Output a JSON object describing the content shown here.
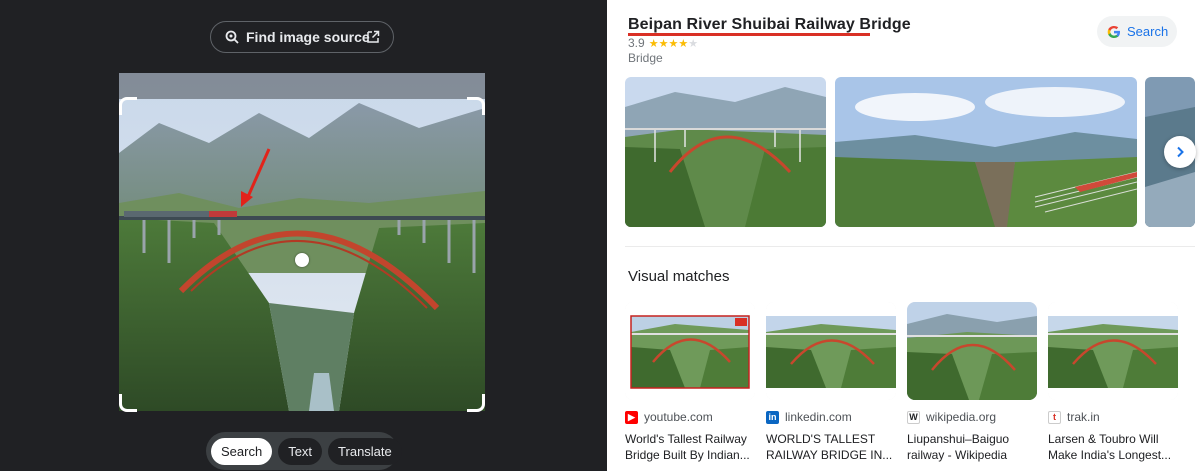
{
  "lens": {
    "find_source_label": "Find image source",
    "modes": [
      "Search",
      "Text",
      "Translate"
    ],
    "active_mode": "Search"
  },
  "entity": {
    "title": "Beipan River Shuibai Railway Bridge",
    "rating": "3.9",
    "rating_value": 3.9,
    "rating_max": 5,
    "type": "Bridge",
    "search_label": "Search"
  },
  "visual_matches": {
    "heading": "Visual matches",
    "items": [
      {
        "source": "youtube.com",
        "caption_line1": "World's Tallest Railway",
        "caption_line2": "Bridge Built By Indian..."
      },
      {
        "source": "linkedin.com",
        "caption_line1": "WORLD'S TALLEST",
        "caption_line2": "RAILWAY BRIDGE IN..."
      },
      {
        "source": "wikipedia.org",
        "caption_line1": "Liupanshui–Baiguo",
        "caption_line2": "railway - Wikipedia"
      },
      {
        "source": "trak.in",
        "caption_line1": "Larsen & Toubro Will",
        "caption_line2": "Make India's Longest..."
      }
    ]
  },
  "colors": {
    "accent_red": "#d93025",
    "star": "#fbbc04",
    "link_blue": "#1a73e8",
    "dark_bg": "#202124"
  }
}
